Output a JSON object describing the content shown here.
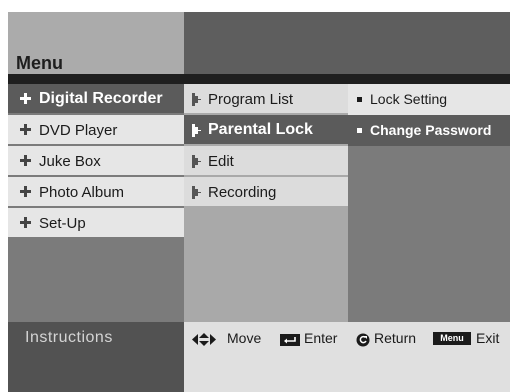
{
  "header": {
    "title": "Menu"
  },
  "main_menu": [
    {
      "label": "Digital Recorder",
      "selected": true,
      "icon": "cross-bullet-icon"
    },
    {
      "label": "DVD Player",
      "selected": false,
      "icon": "cross-bullet-icon"
    },
    {
      "label": "Juke Box",
      "selected": false,
      "icon": "cross-bullet-icon"
    },
    {
      "label": "Photo Album",
      "selected": false,
      "icon": "cross-bullet-icon"
    },
    {
      "label": "Set-Up",
      "selected": false,
      "icon": "cross-bullet-icon"
    }
  ],
  "sub_menu": [
    {
      "label": "Program List",
      "selected": false,
      "icon": "step-arrow-icon"
    },
    {
      "label": "Parental Lock",
      "selected": true,
      "icon": "step-arrow-icon"
    },
    {
      "label": "Edit",
      "selected": false,
      "icon": "step-arrow-icon"
    },
    {
      "label": "Recording",
      "selected": false,
      "icon": "step-arrow-icon"
    }
  ],
  "options": [
    {
      "label": "Lock Setting",
      "selected": false
    },
    {
      "label": "Change Password",
      "selected": true
    }
  ],
  "instructions": {
    "title": "Instructions",
    "move": "Move",
    "enter": "Enter",
    "return": "Return",
    "menu_key": "Menu",
    "exit": "Exit"
  },
  "colors": {
    "selected_bg": "#5b5b5b",
    "item_bg": "#e6e6e6",
    "header_bg": "#5e5e5e",
    "separator": "#1f1f1f"
  }
}
